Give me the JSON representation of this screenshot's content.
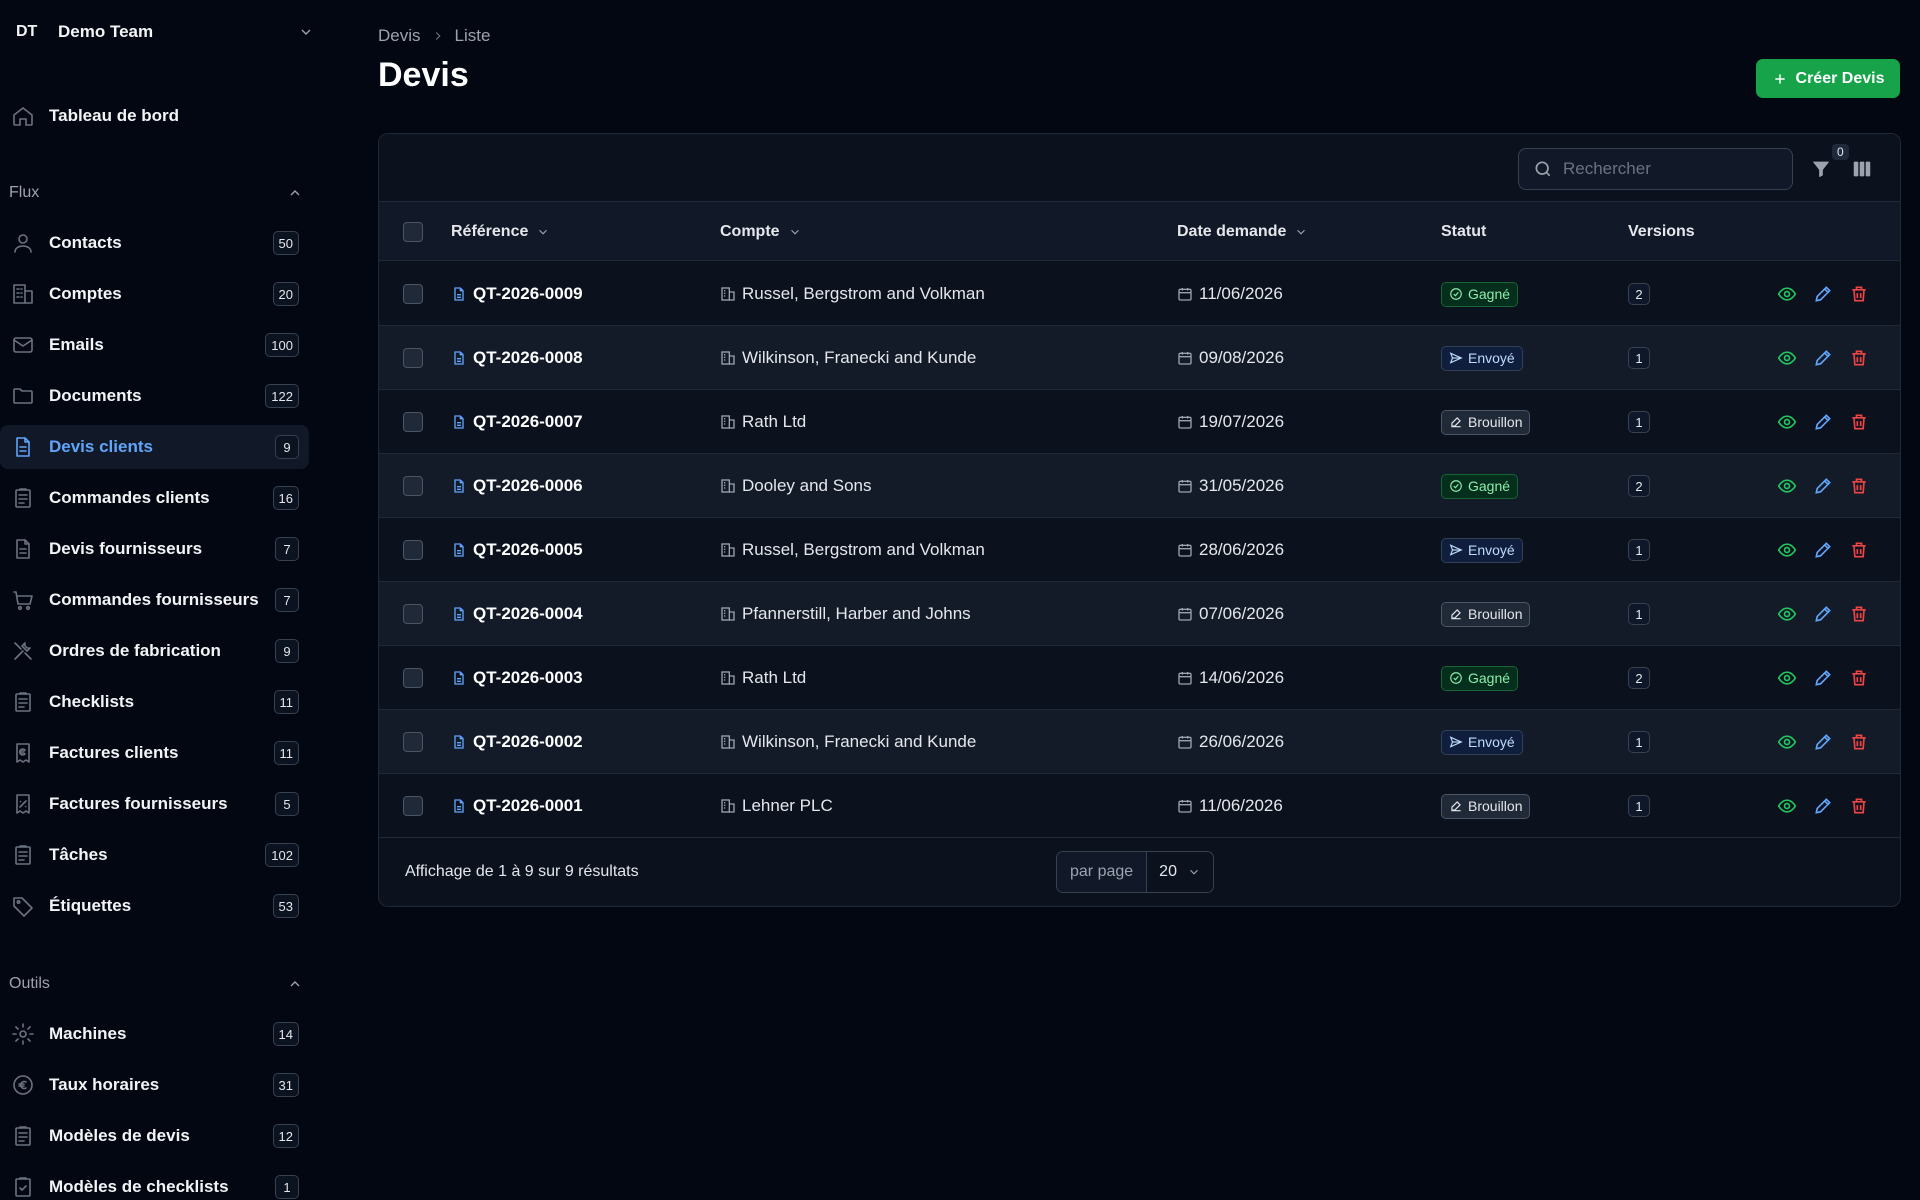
{
  "team": {
    "initials": "DT",
    "name": "Demo Team"
  },
  "nav": {
    "dashboard": "Tableau de bord",
    "flux_label": "Flux",
    "flux_items": [
      {
        "label": "Contacts",
        "count": "50",
        "icon": "user-icon"
      },
      {
        "label": "Comptes",
        "count": "20",
        "icon": "building-icon"
      },
      {
        "label": "Emails",
        "count": "100",
        "icon": "mail-icon"
      },
      {
        "label": "Documents",
        "count": "122",
        "icon": "folder-icon"
      },
      {
        "label": "Devis clients",
        "count": "9",
        "icon": "document-icon",
        "active": true
      },
      {
        "label": "Commandes clients",
        "count": "16",
        "icon": "clipboard-icon"
      },
      {
        "label": "Devis fournisseurs",
        "count": "7",
        "icon": "document-icon"
      },
      {
        "label": "Commandes fournisseurs",
        "count": "7",
        "icon": "cart-icon"
      },
      {
        "label": "Ordres de fabrication",
        "count": "9",
        "icon": "tools-icon"
      },
      {
        "label": "Checklists",
        "count": "11",
        "icon": "clipboard-icon"
      },
      {
        "label": "Factures clients",
        "count": "11",
        "icon": "invoice-euro-icon"
      },
      {
        "label": "Factures fournisseurs",
        "count": "5",
        "icon": "invoice-percent-icon"
      },
      {
        "label": "Tâches",
        "count": "102",
        "icon": "clipboard-icon"
      },
      {
        "label": "Étiquettes",
        "count": "53",
        "icon": "tag-icon"
      }
    ],
    "outils_label": "Outils",
    "outils_items": [
      {
        "label": "Machines",
        "count": "14",
        "icon": "gear-icon"
      },
      {
        "label": "Taux horaires",
        "count": "31",
        "icon": "euro-icon"
      },
      {
        "label": "Modèles de devis",
        "count": "12",
        "icon": "clipboard-icon"
      },
      {
        "label": "Modèles de checklists",
        "count": "1",
        "icon": "clipboard-check-icon"
      }
    ]
  },
  "breadcrumb": {
    "root": "Devis",
    "current": "Liste"
  },
  "page": {
    "title": "Devis",
    "create_label": "Créer Devis"
  },
  "toolbar": {
    "search_placeholder": "Rechercher",
    "filter_count": "0"
  },
  "table": {
    "headers": {
      "reference": "Référence",
      "account": "Compte",
      "date": "Date demande",
      "status": "Statut",
      "versions": "Versions"
    },
    "rows": [
      {
        "ref": "QT-2026-0009",
        "account": "Russel, Bergstrom and Volkman",
        "date": "11/06/2026",
        "status": "Gagné",
        "status_kind": "won",
        "versions": "2"
      },
      {
        "ref": "QT-2026-0008",
        "account": "Wilkinson, Franecki and Kunde",
        "date": "09/08/2026",
        "status": "Envoyé",
        "status_kind": "sent",
        "versions": "1"
      },
      {
        "ref": "QT-2026-0007",
        "account": "Rath Ltd",
        "date": "19/07/2026",
        "status": "Brouillon",
        "status_kind": "draft",
        "versions": "1"
      },
      {
        "ref": "QT-2026-0006",
        "account": "Dooley and Sons",
        "date": "31/05/2026",
        "status": "Gagné",
        "status_kind": "won",
        "versions": "2"
      },
      {
        "ref": "QT-2026-0005",
        "account": "Russel, Bergstrom and Volkman",
        "date": "28/06/2026",
        "status": "Envoyé",
        "status_kind": "sent",
        "versions": "1"
      },
      {
        "ref": "QT-2026-0004",
        "account": "Pfannerstill, Harber and Johns",
        "date": "07/06/2026",
        "status": "Brouillon",
        "status_kind": "draft",
        "versions": "1"
      },
      {
        "ref": "QT-2026-0003",
        "account": "Rath Ltd",
        "date": "14/06/2026",
        "status": "Gagné",
        "status_kind": "won",
        "versions": "2"
      },
      {
        "ref": "QT-2026-0002",
        "account": "Wilkinson, Franecki and Kunde",
        "date": "26/06/2026",
        "status": "Envoyé",
        "status_kind": "sent",
        "versions": "1"
      },
      {
        "ref": "QT-2026-0001",
        "account": "Lehner PLC",
        "date": "11/06/2026",
        "status": "Brouillon",
        "status_kind": "draft",
        "versions": "1"
      }
    ]
  },
  "pagination": {
    "summary": "Affichage de 1 à 9 sur 9 résultats",
    "per_page_label": "par page",
    "per_page_value": "20"
  },
  "colors": {
    "accent": "#60a5fa",
    "primary_button": "#16a34a",
    "background": "#030712",
    "danger": "#ef4444",
    "success": "#22c55e"
  }
}
